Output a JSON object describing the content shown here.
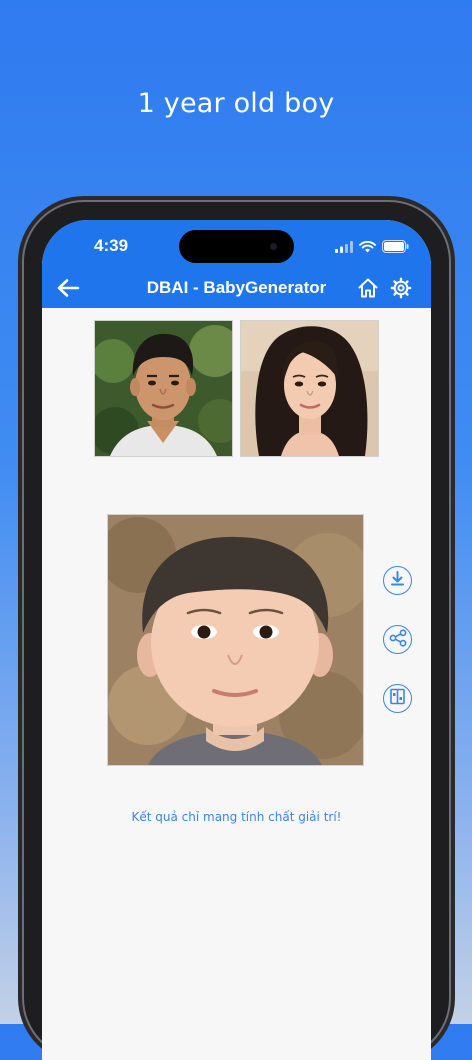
{
  "promo": {
    "headline": "1 year old boy"
  },
  "status_bar": {
    "time": "4:39"
  },
  "nav": {
    "title": "DBAI - BabyGenerator",
    "back_icon": "arrow-left-icon",
    "home_icon": "home-icon",
    "settings_icon": "gear-icon"
  },
  "parents": [
    {
      "role": "father",
      "icon": "person-photo"
    },
    {
      "role": "mother",
      "icon": "person-photo"
    }
  ],
  "result": {
    "icon": "baby-photo"
  },
  "actions": [
    {
      "name": "download",
      "icon": "download-icon"
    },
    {
      "name": "share",
      "icon": "share-icon"
    },
    {
      "name": "compare",
      "icon": "compare-icon"
    }
  ],
  "disclaimer": "Kết quả chỉ mang tính chất giải trí!",
  "colors": {
    "accent": "#1f76ec",
    "background": "#f7f7f8"
  }
}
